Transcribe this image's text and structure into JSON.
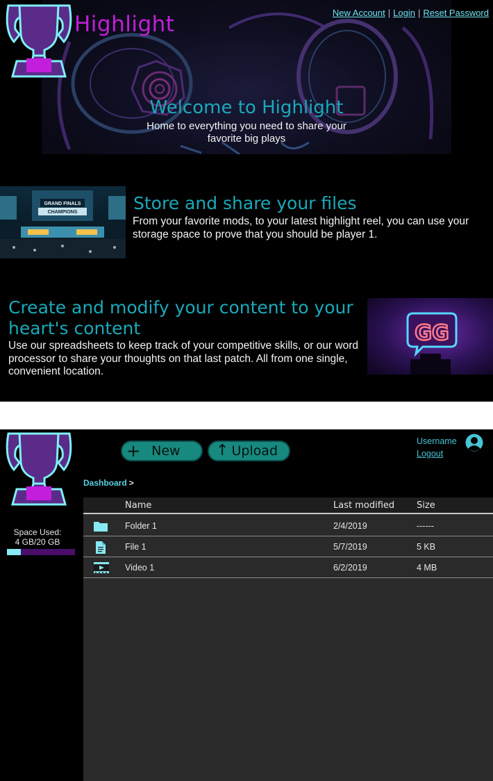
{
  "landing": {
    "brand": "Highlight",
    "auth_links": {
      "new_account": "New Account",
      "login": "Login",
      "reset_password": "Reset Password",
      "separator": "|"
    },
    "welcome_title": "Welcome to Highlight",
    "welcome_subtitle": "Home to everything you need to share your favorite big plays",
    "feature1": {
      "title": "Store and share your files",
      "text": "From your favorite mods, to your latest highlight reel, you can use your storage space to prove that you should be player 1.",
      "image_caption_top": "GRAND FINALS",
      "image_caption_bottom": "CHAMPIONS"
    },
    "feature2": {
      "title": "Create and modify your content to your heart's content",
      "text": "Use our spreadsheets to keep track of your competitive skills, or our word processor to share your thoughts on that last patch. All from one single, convenient location.",
      "neon_sign": "GG"
    }
  },
  "dashboard": {
    "buttons": {
      "new_glyph": "+",
      "new_label": "New",
      "upload_glyph": "↑",
      "upload_label": "Upload"
    },
    "user": {
      "name": "Username",
      "logout": "Logout"
    },
    "breadcrumb": {
      "current": "Dashboard",
      "separator": ">"
    },
    "storage": {
      "label": "Space Used:",
      "value": "4 GB/20 GB",
      "used_fraction": 0.2
    },
    "table": {
      "headers": {
        "name": "Name",
        "modified": "Last modified",
        "size": "Size"
      },
      "rows": [
        {
          "icon": "folder-icon",
          "name": "Folder 1",
          "modified": "2/4/2019",
          "size": "------"
        },
        {
          "icon": "file-icon",
          "name": "File 1",
          "modified": "5/7/2019",
          "size": "5 KB"
        },
        {
          "icon": "video-icon",
          "name": "Video 1",
          "modified": "6/2/2019",
          "size": "4 MB"
        }
      ]
    }
  },
  "colors": {
    "brand": "#c21edb",
    "accent_teal": "#1aa9b9",
    "link_cyan": "#6fe3ee",
    "button": "#17897f",
    "storage_fill": "#86e9f3",
    "storage_track": "#4b0d6a",
    "trophy": "#5b2b8a"
  }
}
